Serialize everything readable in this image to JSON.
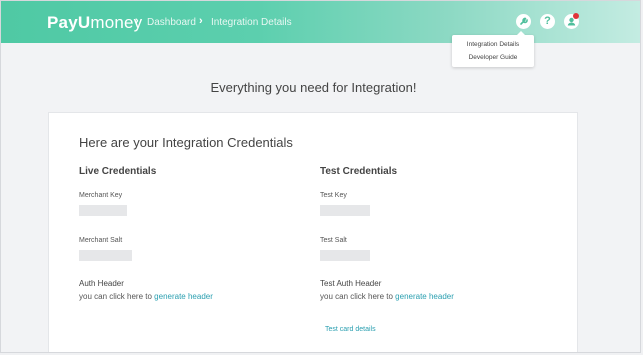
{
  "header": {
    "logo_payu": "PayU",
    "logo_money": "money",
    "breadcrumb": [
      "Dashboard",
      "Integration Details"
    ],
    "icons": [
      "wrench-icon",
      "help-icon",
      "user-icon"
    ],
    "help_glyph": "?"
  },
  "dropdown": {
    "items": [
      "Integration Details",
      "Developer Guide"
    ]
  },
  "main": {
    "title": "Everything you need for Integration!",
    "card_title": "Here are your Integration Credentials",
    "live": {
      "title": "Live Credentials",
      "key_label": "Merchant Key",
      "salt_label": "Merchant Salt",
      "auth_title": "Auth Header",
      "auth_text": "you can click here to",
      "auth_link": "generate header"
    },
    "test": {
      "title": "Test Credentials",
      "key_label": "Test Key",
      "salt_label": "Test Salt",
      "auth_title": "Test Auth Header",
      "auth_text": "you can click here to",
      "auth_link": "generate header"
    },
    "test_card_link": "Test card details"
  },
  "colors": {
    "header_start": "#4fc9a4",
    "header_end": "#c4ece2",
    "link": "#2a9fb0",
    "notification_dot": "#e0343a"
  }
}
